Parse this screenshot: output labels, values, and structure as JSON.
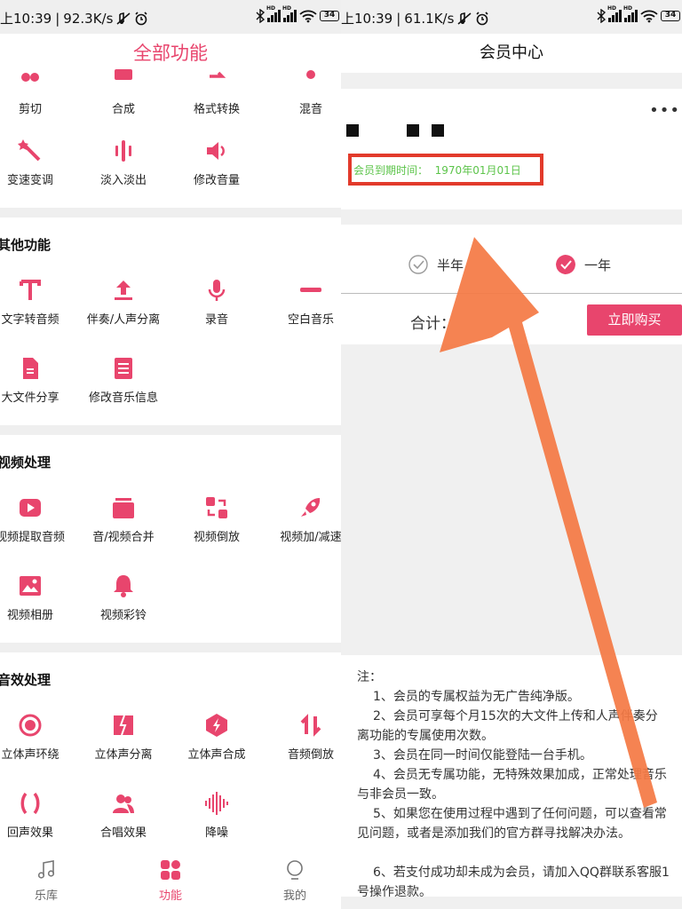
{
  "left": {
    "status": {
      "time": "上10:39",
      "speed": "92.3K/s",
      "battery": "34"
    },
    "title": "全部功能",
    "top_row": [
      "剪切",
      "合成",
      "格式转换",
      "混音"
    ],
    "top_row2": [
      "变速变调",
      "淡入淡出",
      "修改音量"
    ],
    "other": {
      "title": "其他功能",
      "items": [
        "文字转音频",
        "伴奏/人声分离",
        "录音",
        "空白音乐",
        "大文件分享",
        "修改音乐信息"
      ]
    },
    "video": {
      "title": "视频处理",
      "items": [
        "视频提取音频",
        "音/视频合并",
        "视频倒放",
        "视频加/减速",
        "视频相册",
        "视频彩铃"
      ]
    },
    "effects": {
      "title": "音效处理",
      "items": [
        "立体声环绕",
        "立体声分离",
        "立体声合成",
        "音频倒放",
        "回声效果",
        "合唱效果",
        "降噪"
      ]
    },
    "nav": [
      "乐库",
      "功能",
      "我的"
    ]
  },
  "right": {
    "status": {
      "time": "上10:39",
      "speed": "61.1K/s",
      "battery": "34"
    },
    "title": "会员中心",
    "more": "•••",
    "expire_label": "会员到期时间：",
    "expire_date": "1970年01月01日",
    "plan_half": "半年",
    "plan_year": "一年",
    "total_label": "合计：",
    "buy_label": "立即购买",
    "notes_title": "注：",
    "notes": [
      "1、会员的专属权益为无广告纯净版。",
      "2、会员可享每个月15次的大文件上传和人声伴奏分离功能的专属使用次数。",
      "3、会员在同一时间仅能登陆一台手机。",
      "4、会员无专属功能，无特殊效果加成，正常处理音乐与非会员一致。",
      "5、如果您在使用过程中遇到了任何问题，可以查看常见问题，或者是添加我们的官方群寻找解决办法。",
      "6、若支付成功却未成为会员，请加入QQ群联系客服1号操作退款。"
    ]
  },
  "colors": {
    "accent": "#e8456d",
    "annotation": "#f47a45",
    "highlight_box": "#e23a2b",
    "expire_text": "#5cc44a"
  }
}
